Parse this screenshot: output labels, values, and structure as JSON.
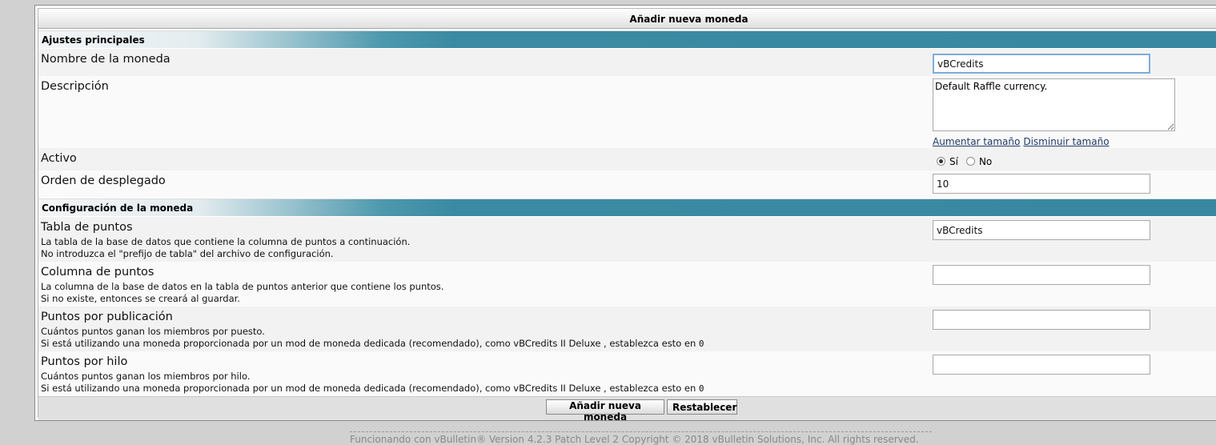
{
  "form": {
    "title": "Añadir nueva moneda",
    "sections": {
      "main": "Ajustes principales",
      "config": "Configuración de la moneda"
    },
    "fields": {
      "name": {
        "label": "Nombre de la moneda",
        "value": "vBCredits"
      },
      "description": {
        "label": "Descripción",
        "value": "Default Raffle currency.",
        "enlarge_link": "Aumentar tamaño",
        "shrink_link": "Disminuir tamaño"
      },
      "active": {
        "label": "Activo",
        "yes": "Sí",
        "no": "No",
        "selected": "Sí"
      },
      "display_order": {
        "label": "Orden de desplegado",
        "value": "10"
      },
      "points_table": {
        "label": "Tabla de puntos",
        "desc1": "La tabla de la base de datos que contiene la columna de puntos a continuación.",
        "desc2": "No introduzca el \"prefijo de tabla\" del archivo de configuración.",
        "value": "vBCredits"
      },
      "points_column": {
        "label": "Columna de puntos",
        "desc1": "La columna de la base de datos en la tabla de puntos anterior que contiene los puntos.",
        "desc2": "Si no existe, entonces se creará al guardar.",
        "value": ""
      },
      "points_per_post": {
        "label": "Puntos por publicación",
        "desc1": "Cuántos puntos ganan los miembros por puesto.",
        "desc2": "Si está utilizando una moneda proporcionada por un mod de moneda dedicada (recomendado), como vBCredits II Deluxe , establezca esto en",
        "code": "0",
        "value": ""
      },
      "points_per_thread": {
        "label": "Puntos por hilo",
        "desc1": "Cuántos puntos ganan los miembros por hilo.",
        "desc2": "Si está utilizando una moneda proporcionada por un mod de moneda dedicada (recomendado), como vBCredits II Deluxe , establezca esto en",
        "code": "0",
        "value": ""
      }
    },
    "buttons": {
      "submit": "Añadir nueva moneda",
      "reset": "Restablecer"
    }
  },
  "footer": {
    "copyright": "Funcionando con vBulletin® Version 4.2.3 Patch Level 2 Copyright © 2018 vBulletin Solutions, Inc. All rights reserved."
  },
  "colors": {
    "section_header": "#3888a1",
    "page_background": "#d1d1d1",
    "link": "#1f3a66"
  }
}
